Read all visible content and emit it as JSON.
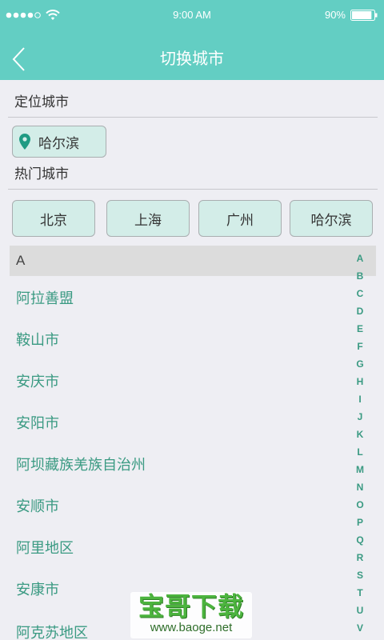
{
  "status_bar": {
    "time": "9:00 AM",
    "battery_text": "90%",
    "battery_level": 0.9,
    "signal": {
      "filled": 4,
      "total": 5
    },
    "wifi_icon": "wifi-icon",
    "battery_icon": "battery-icon"
  },
  "nav": {
    "title": "切换城市",
    "back_icon": "chevron-left-icon"
  },
  "location_section": {
    "label": "定位城市",
    "city": "哈尔滨",
    "icon": "location-pin-icon"
  },
  "hot_section": {
    "label": "热门城市",
    "cities": [
      "北京",
      "上海",
      "广州",
      "哈尔滨"
    ]
  },
  "city_list": {
    "header": "A",
    "cities": [
      "阿拉善盟",
      "鞍山市",
      "安庆市",
      "安阳市",
      "阿坝藏族羌族自治州",
      "安顺市",
      "阿里地区",
      "安康市",
      "阿克苏地区"
    ]
  },
  "index_bar": {
    "letters": [
      "A",
      "B",
      "C",
      "D",
      "E",
      "F",
      "G",
      "H",
      "I",
      "J",
      "K",
      "L",
      "M",
      "N",
      "O",
      "P",
      "Q",
      "R",
      "S",
      "T",
      "U",
      "V"
    ]
  },
  "watermark": {
    "title": "宝哥下载",
    "url": "www.baoge.net"
  },
  "colors": {
    "accent": "#63cec3",
    "city_text": "#3a9a82",
    "chip_bg": "#d3ede8",
    "page_bg": "#eeeef3"
  }
}
